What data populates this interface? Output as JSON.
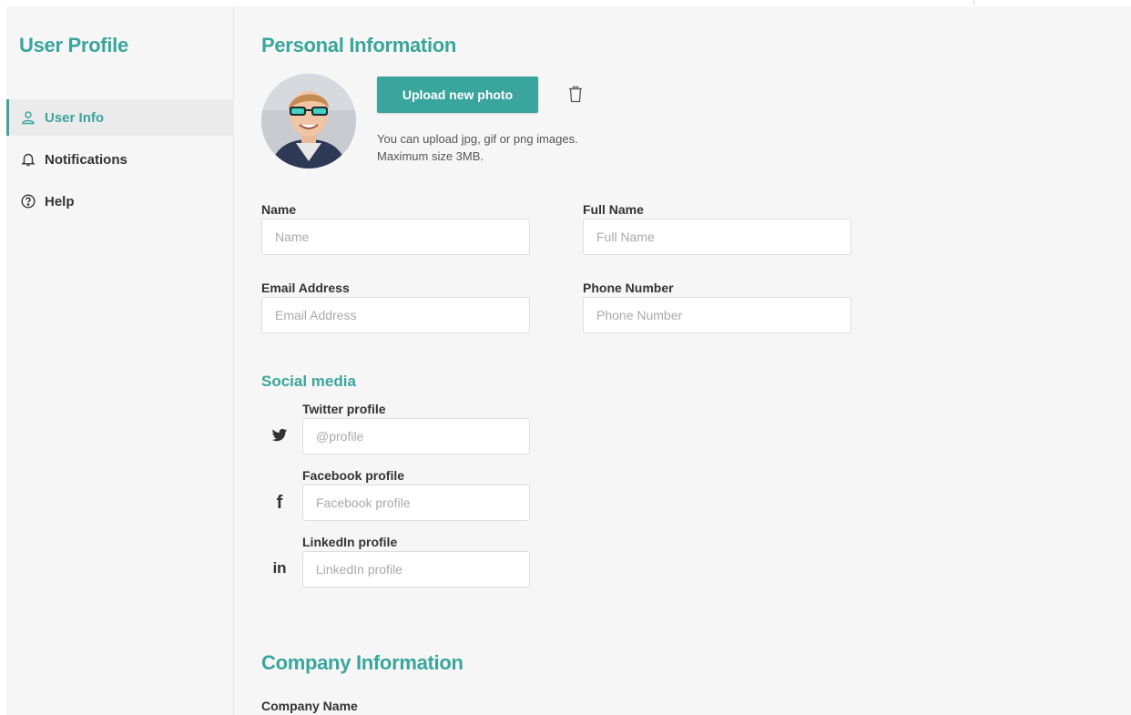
{
  "sidebar": {
    "title": "User Profile",
    "items": [
      {
        "label": "User Info",
        "icon": "user-icon",
        "active": true
      },
      {
        "label": "Notifications",
        "icon": "bell-icon",
        "active": false
      },
      {
        "label": "Help",
        "icon": "help-circle-icon",
        "active": false
      }
    ]
  },
  "personal": {
    "title": "Personal Information",
    "upload_label": "Upload new photo",
    "upload_help_line1": "You can upload jpg, gif or png images.",
    "upload_help_line2": "Maximum size 3MB.",
    "fields": {
      "name": {
        "label": "Name",
        "placeholder": "Name",
        "value": ""
      },
      "full_name": {
        "label": "Full Name",
        "placeholder": "Full Name",
        "value": ""
      },
      "email": {
        "label": "Email Address",
        "placeholder": "Email Address",
        "value": ""
      },
      "phone": {
        "label": "Phone Number",
        "placeholder": "Phone Number",
        "value": ""
      }
    }
  },
  "social": {
    "title": "Social media",
    "twitter": {
      "label": "Twitter profile",
      "placeholder": "@profile",
      "icon": "twitter-icon"
    },
    "facebook": {
      "label": "Facebook profile",
      "placeholder": "Facebook profile",
      "icon": "facebook-icon",
      "glyph": "f"
    },
    "linkedin": {
      "label": "LinkedIn profile",
      "placeholder": "LinkedIn profile",
      "icon": "linkedin-icon",
      "glyph": "in"
    }
  },
  "company": {
    "title": "Company Information",
    "company_name_label": "Company Name"
  },
  "colors": {
    "accent": "#3aa59d",
    "background": "#f6f6f6",
    "active_nav_bg": "#ebebeb"
  }
}
